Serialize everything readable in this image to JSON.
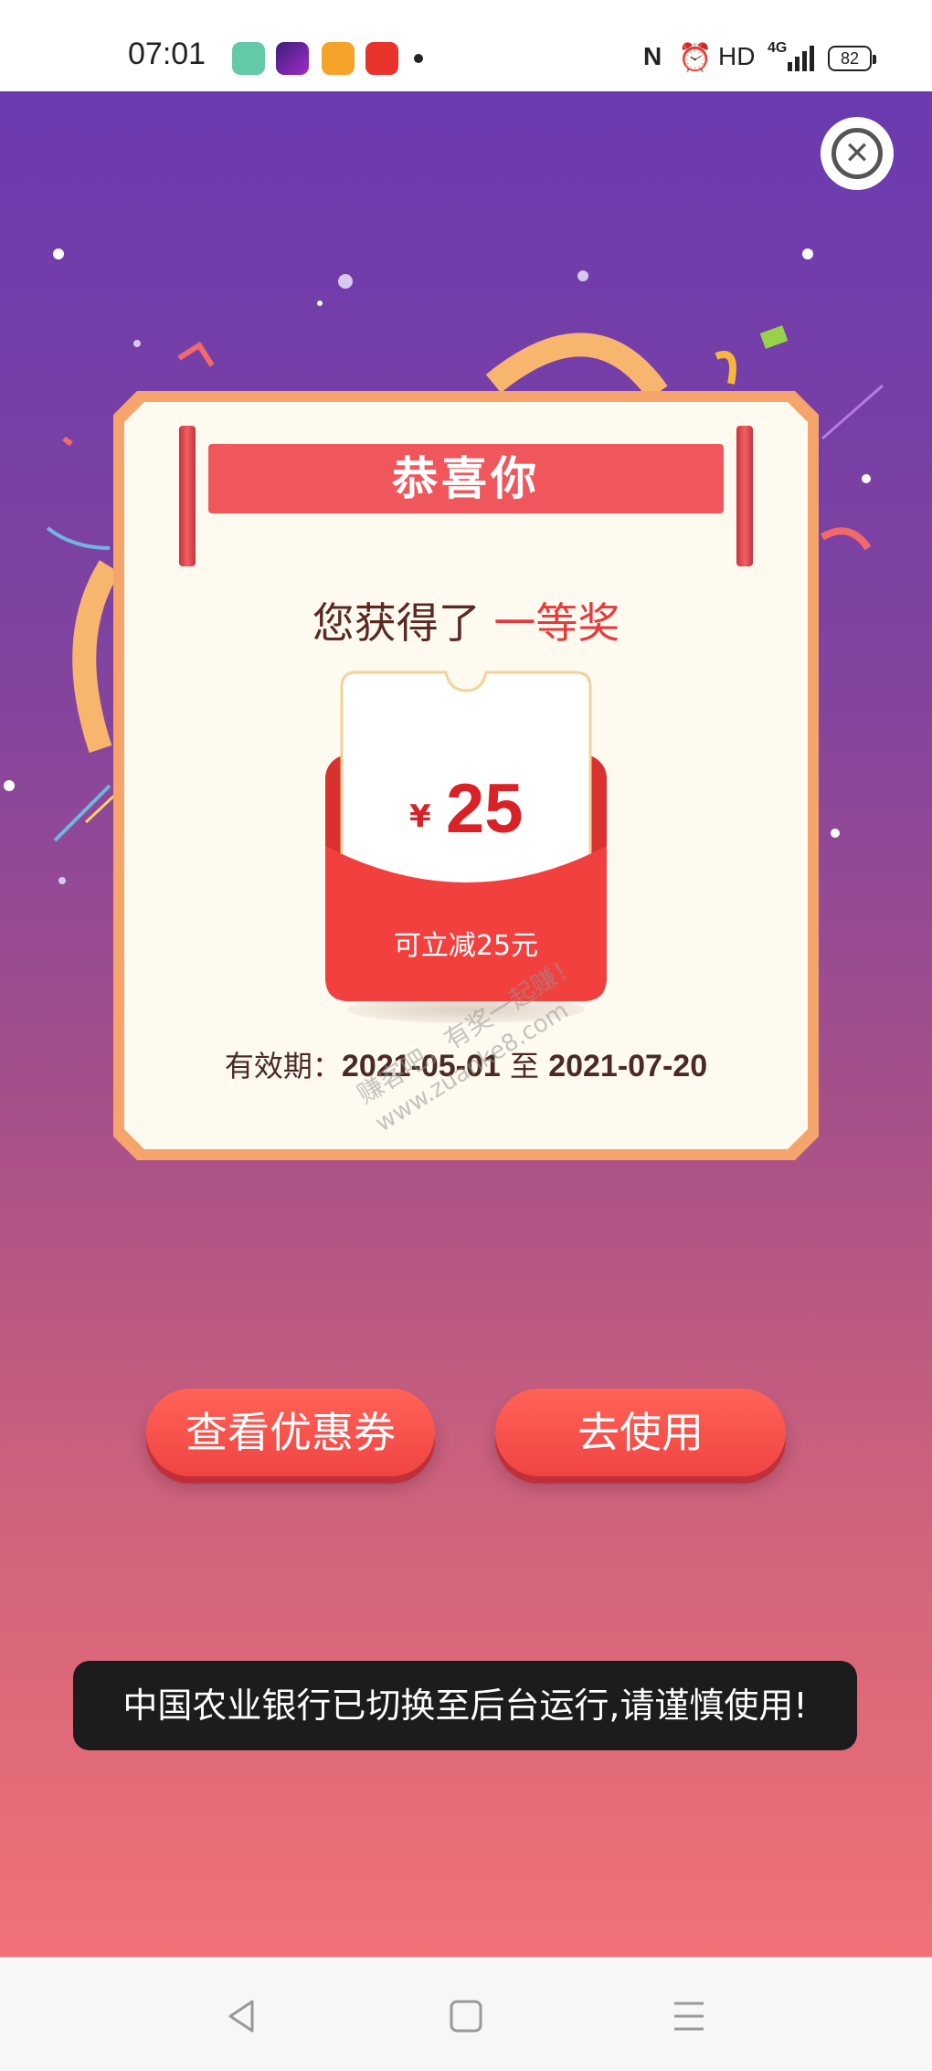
{
  "status_bar": {
    "time": "07:01",
    "hd_label": "HD",
    "network_label": "4G",
    "battery_level": "82"
  },
  "popup": {
    "banner_title": "恭喜你",
    "prize_prefix": "您获得了",
    "prize_level": "一等奖",
    "coupon": {
      "currency_symbol": "¥",
      "amount": "25",
      "discount_text": "可立减25元"
    },
    "validity": {
      "label": "有效期：",
      "start_date": "2021-05-01",
      "separator": "至",
      "end_date": "2021-07-20"
    },
    "watermark_line1": "赚客吧，有奖一起赚！",
    "watermark_line2": "www.zuanke8.com"
  },
  "actions": {
    "view_coupons_label": "查看优惠券",
    "use_now_label": "去使用"
  },
  "toast": {
    "message": "中国农业银行已切换至后台运行,请谨慎使用!"
  },
  "colors": {
    "accent_red": "#f04443",
    "banner_red": "#f0575c",
    "card_border": "#f5a46b",
    "card_bg": "#fffaf0"
  }
}
